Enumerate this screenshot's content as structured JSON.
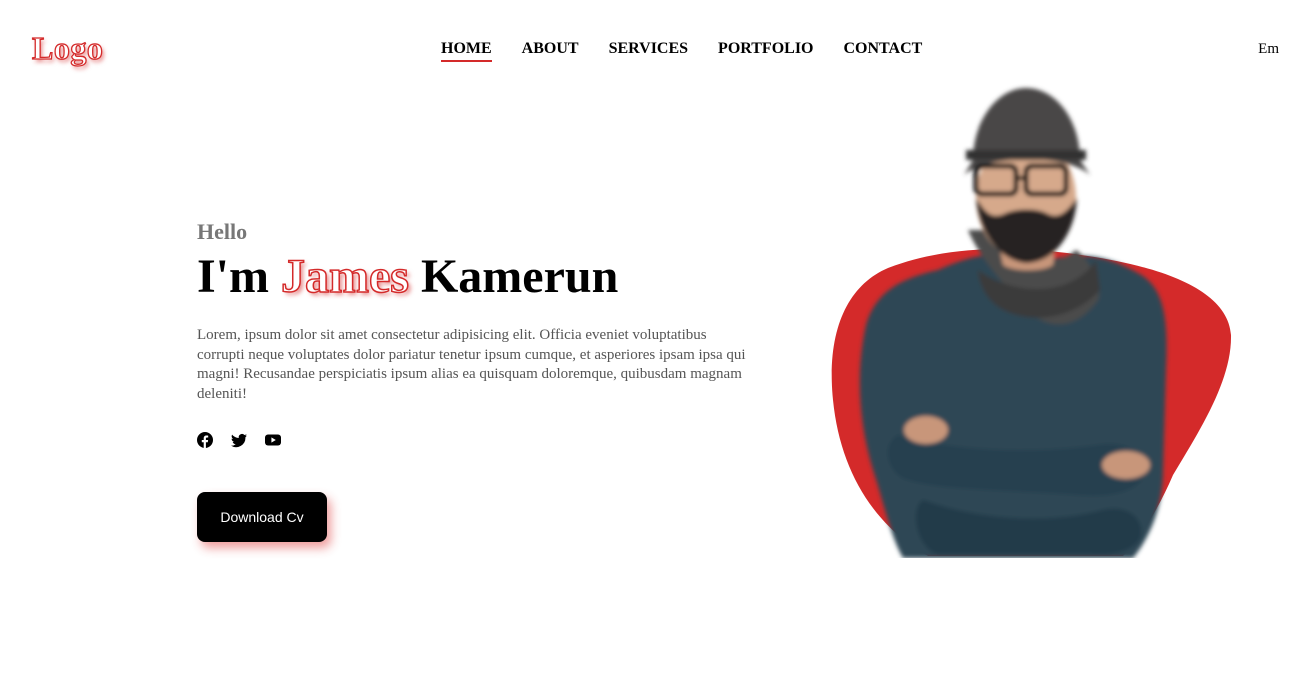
{
  "header": {
    "logo": "Logo",
    "nav": [
      "HOME",
      "ABOUT",
      "SERVICES",
      "PORTFOLIO",
      "CONTACT"
    ],
    "language": "Em"
  },
  "hero": {
    "greeting": "Hello",
    "title_prefix": "I'm ",
    "title_accent": "James",
    "title_suffix": " Kamerun",
    "description": "Lorem, ipsum dolor sit amet consectetur adipisicing elit. Officia eveniet voluptatibus corrupti neque voluptates dolor pariatur tenetur ipsum cumque, et asperiores ipsam ipsa qui magni! Recusandae perspiciatis ipsum alias ea quisquam doloremque, quibusdam magnam deleniti!",
    "socials": [
      "facebook-icon",
      "twitter-icon",
      "youtube-icon"
    ],
    "cta_label": "Download Cv"
  },
  "colors": {
    "accent": "#d42a2a",
    "button_bg": "#000000",
    "sweater": "#2d4755"
  }
}
